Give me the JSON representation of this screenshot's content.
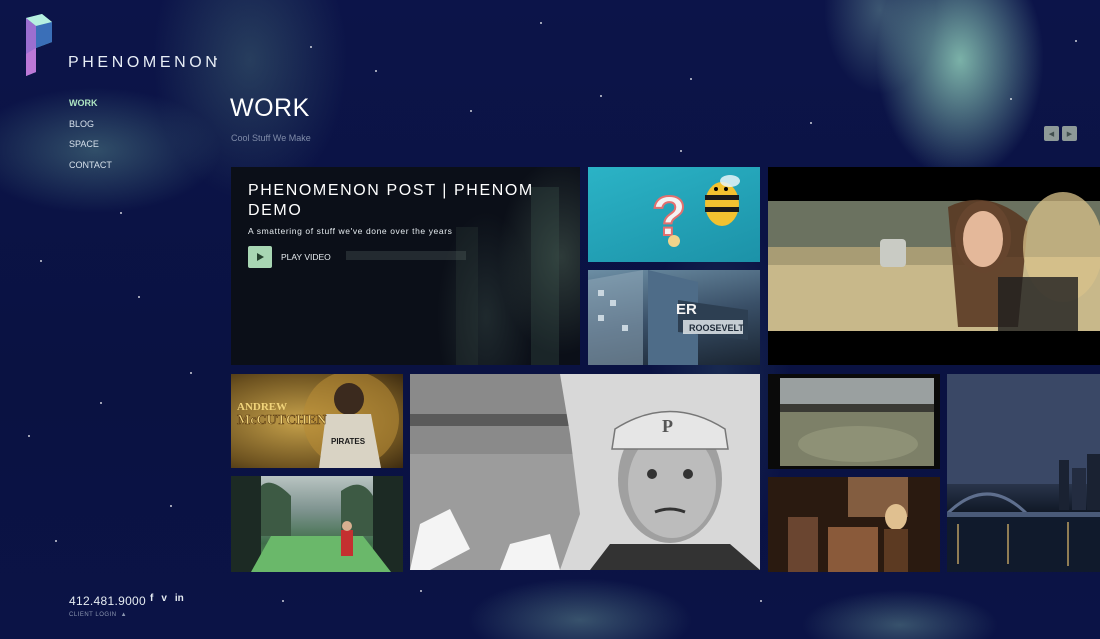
{
  "brand": {
    "name": "PHENOMENON"
  },
  "nav": {
    "items": [
      {
        "label": "WORK",
        "active": true
      },
      {
        "label": "BLOG",
        "active": false
      },
      {
        "label": "SPACE",
        "active": false
      },
      {
        "label": "CONTACT",
        "active": false
      }
    ]
  },
  "header": {
    "title": "WORK",
    "subtitle": "Cool Stuff We Make"
  },
  "slider": {
    "prev_icon": "chevron-left-icon",
    "next_icon": "chevron-right-icon"
  },
  "featured": {
    "title": "PHENOMENON POST | PHENOM DEMO",
    "description": "A smattering of stuff we've done over the years",
    "play_label": "PLAY VIDEO"
  },
  "thumbnails": {
    "andrew_caption_top": "ANDREW",
    "andrew_caption_bottom": "McCUTCHEN",
    "building_sign": "ROOSEVELT",
    "building_letters": "ER",
    "wagner_cap_letter": "P"
  },
  "footer": {
    "phone": "412.481.9000",
    "social": {
      "facebook": "f",
      "vimeo": "v",
      "linkedin": "in"
    },
    "client_login": "CLIENT LOGIN"
  },
  "colors": {
    "background": "#0b1247",
    "accent": "#aee6c2",
    "play_button": "#a8d6b3"
  }
}
